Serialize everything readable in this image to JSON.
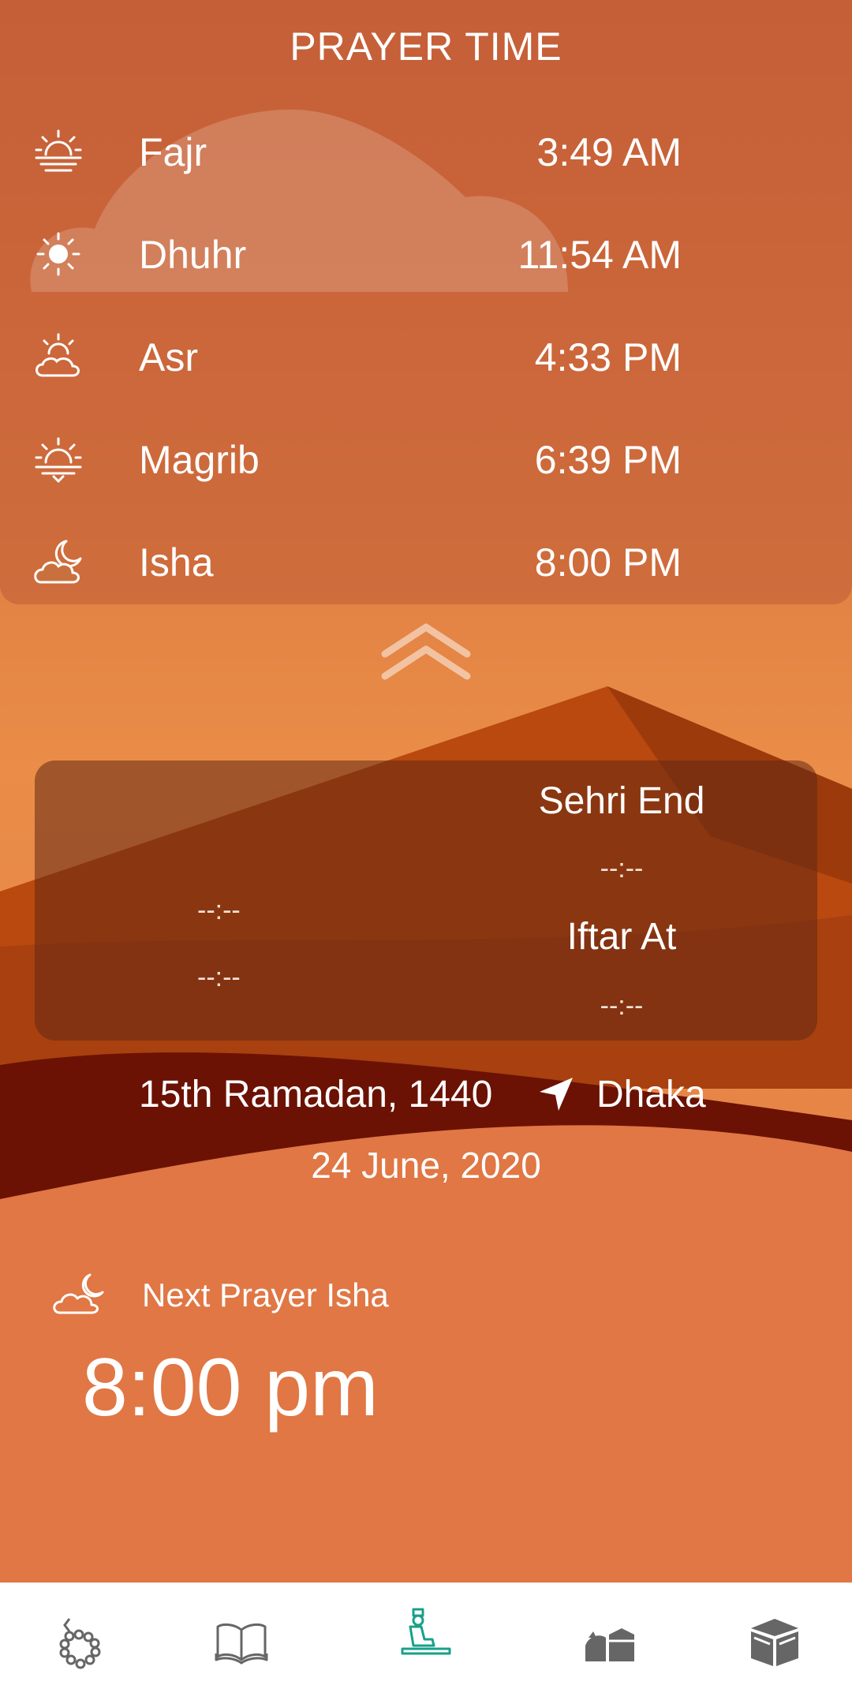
{
  "header": {
    "title": "PRAYER TIME"
  },
  "prayers": [
    {
      "name": "Fajr",
      "time": "3:49 AM",
      "icon": "sunrise-icon"
    },
    {
      "name": "Dhuhr",
      "time": "11:54 AM",
      "icon": "sun-icon"
    },
    {
      "name": "Asr",
      "time": "4:33 PM",
      "icon": "sun-cloud-icon"
    },
    {
      "name": "Magrib",
      "time": "6:39 PM",
      "icon": "sunset-icon"
    },
    {
      "name": "Isha",
      "time": "8:00 PM",
      "icon": "moon-cloud-icon"
    }
  ],
  "fasting": {
    "left_value_1": "--:--",
    "left_value_2": "--:--",
    "sehri_label": "Sehri End",
    "sehri_value": "--:--",
    "iftar_label": "Iftar At",
    "iftar_value": "--:--"
  },
  "date": {
    "hijri": "15th Ramadan, 1440",
    "location": "Dhaka",
    "gregorian": "24 June, 2020"
  },
  "next_prayer": {
    "label": "Next Prayer Isha",
    "time": "8:00 pm"
  },
  "nav": [
    "tasbih-icon",
    "quran-icon",
    "prayer-icon",
    "mosque-icon",
    "kaaba-icon"
  ],
  "colors": {
    "accent": "#19a08a",
    "background": "#e07744"
  }
}
